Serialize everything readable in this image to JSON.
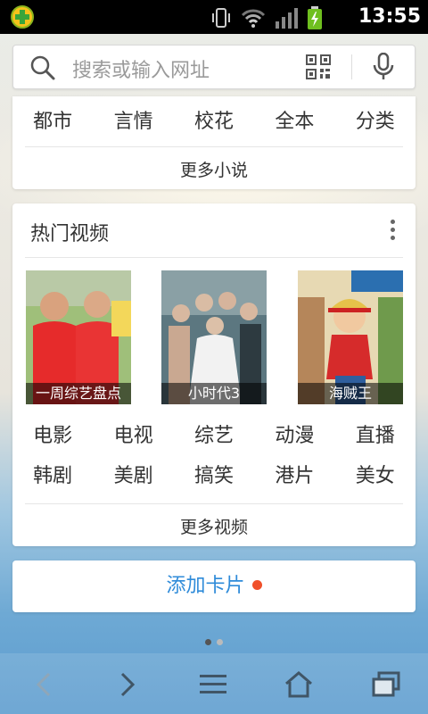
{
  "status_bar": {
    "time": "13:55"
  },
  "search": {
    "placeholder": "搜索或输入网址"
  },
  "novel_card": {
    "links": [
      "都市",
      "言情",
      "校花",
      "全本",
      "分类"
    ],
    "more_label": "更多小说"
  },
  "video_card": {
    "title": "热门视频",
    "thumbnails": [
      {
        "caption": "一周综艺盘点",
        "icon": "variety-show-thumbnail"
      },
      {
        "caption": "小时代3",
        "icon": "movie-poster-thumbnail"
      },
      {
        "caption": "海贼王",
        "icon": "anime-poster-thumbnail"
      }
    ],
    "links_row1": [
      "电影",
      "电视",
      "综艺",
      "动漫",
      "直播"
    ],
    "links_row2": [
      "韩剧",
      "美剧",
      "搞笑",
      "港片",
      "美女"
    ],
    "more_label": "更多视频"
  },
  "add_card": {
    "label": "添加卡片"
  },
  "colors": {
    "accent": "#2f8bd9",
    "dot": "#f0502a"
  },
  "page_indicator": {
    "total": 2,
    "current": 1
  }
}
